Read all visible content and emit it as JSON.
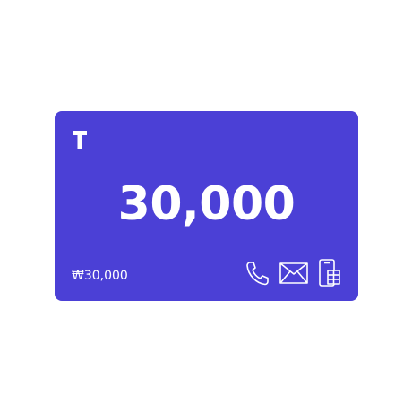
{
  "colors": {
    "card_background": "#4b40d6",
    "foreground": "#ffffff"
  },
  "card": {
    "logo_icon": "t-logo-icon",
    "amount_large": "30,000",
    "amount_small": "₩30,000",
    "delivery_icons": [
      "phone-icon",
      "envelope-icon",
      "mobile-icon"
    ]
  }
}
